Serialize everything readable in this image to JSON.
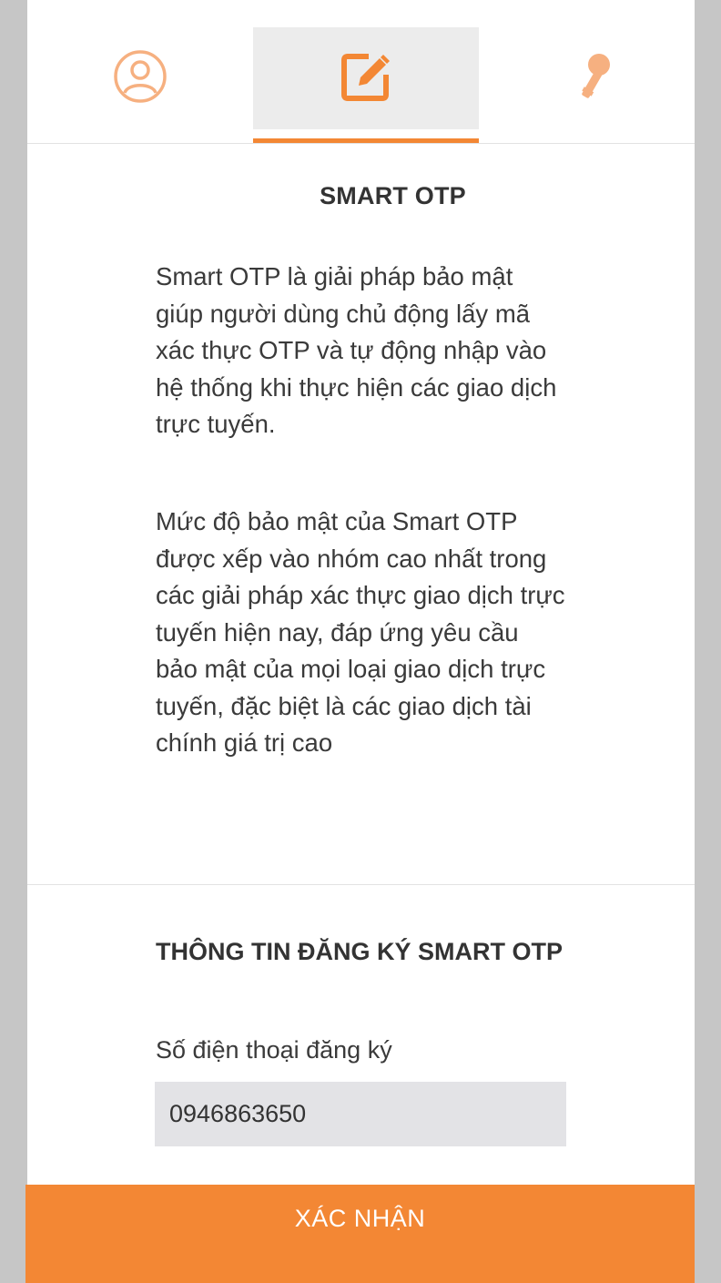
{
  "tabs": [
    {
      "icon": "user-icon",
      "active": false
    },
    {
      "icon": "edit-icon",
      "active": true
    },
    {
      "icon": "key-icon",
      "active": false
    }
  ],
  "colors": {
    "accent": "#f38734",
    "accent_light": "#f6b080",
    "input_bg": "#e3e3e6",
    "tab_active_bg": "#ececec",
    "side_bg": "#c6c6c6"
  },
  "intro": {
    "title": "SMART OTP",
    "paragraph1": "Smart OTP là giải pháp bảo mật giúp người dùng chủ động lấy mã xác thực OTP và tự động nhập vào hệ thống khi thực hiện các giao dịch trực tuyến.",
    "paragraph2": "Mức độ bảo mật của Smart OTP được xếp vào nhóm cao nhất trong các giải pháp xác thực giao dịch trực tuyến hiện nay, đáp ứng yêu cầu bảo mật của mọi loại giao dịch trực tuyến, đặc biệt là các giao dịch tài chính giá trị cao"
  },
  "registration": {
    "title": "THÔNG TIN ĐĂNG KÝ SMART OTP",
    "phone_label": "Số điện thoại đăng ký",
    "phone_value": "0946863650"
  },
  "confirm_label": "XÁC NHẬN"
}
